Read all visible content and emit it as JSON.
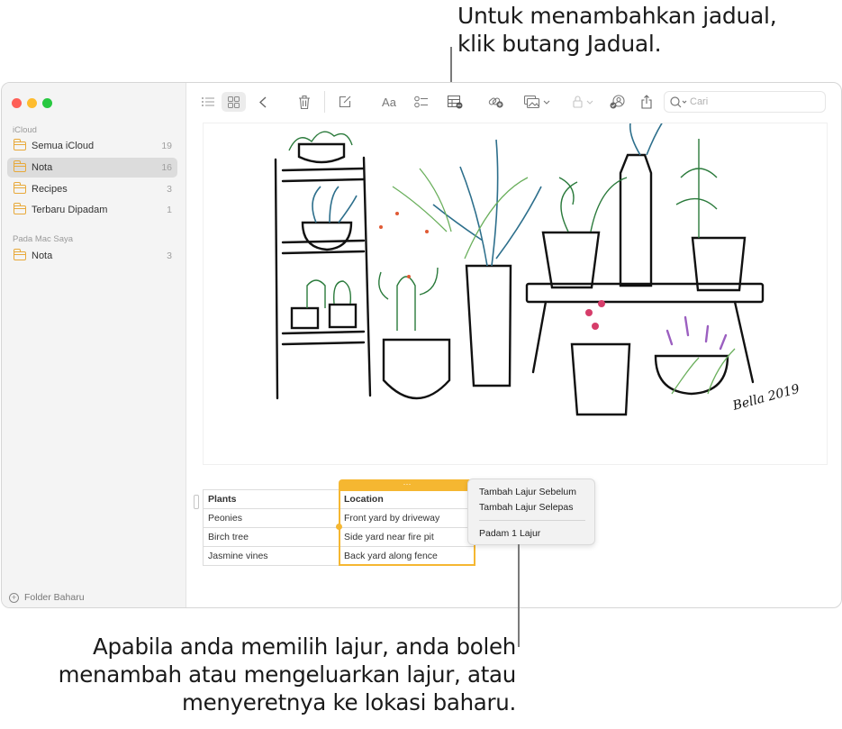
{
  "callouts": {
    "top": [
      "Untuk menambahkan jadual,",
      "klik butang Jadual."
    ],
    "bottom": [
      "Apabila anda memilih lajur, anda boleh",
      "menambah atau mengeluarkan lajur, atau",
      "menyeretnya ke lokasi baharu."
    ]
  },
  "window": {
    "traffic_lights": {
      "close": "#fe5f57",
      "minimize": "#febc2e",
      "zoom": "#28c840"
    }
  },
  "sidebar": {
    "sections": [
      {
        "label": "iCloud",
        "folders": [
          {
            "name": "Semua iCloud",
            "count": "19",
            "selected": false
          },
          {
            "name": "Nota",
            "count": "16",
            "selected": true
          },
          {
            "name": "Recipes",
            "count": "3",
            "selected": false
          },
          {
            "name": "Terbaru Dipadam",
            "count": "1",
            "selected": false
          }
        ]
      },
      {
        "label": "Pada Mac Saya",
        "folders": [
          {
            "name": "Nota",
            "count": "3",
            "selected": false
          }
        ]
      }
    ],
    "new_folder_label": "Folder Baharu"
  },
  "toolbar": {
    "buttons": [
      "list-view",
      "gallery-view",
      "back",
      "delete",
      "compose",
      "format",
      "checklist",
      "table",
      "collaborate",
      "media",
      "lock",
      "share-with",
      "share"
    ],
    "format_label": "Aa",
    "search_placeholder": "Cari"
  },
  "note": {
    "drawing": {
      "signature": "Bella 2019"
    },
    "table": {
      "headers": [
        "Plants",
        "Location"
      ],
      "rows": [
        [
          "Peonies",
          "Front yard by driveway"
        ],
        [
          "Birch tree",
          "Side yard near fire pit"
        ],
        [
          "Jasmine vines",
          "Back yard along fence"
        ]
      ],
      "selected_column": 1,
      "column_handle_label": "···"
    },
    "context_menu": {
      "items": [
        "Tambah Lajur Sebelum",
        "Tambah Lajur Selepas",
        "Padam 1 Lajur"
      ]
    }
  },
  "colors": {
    "accent": "#f5b731",
    "folder": "#e8a93a"
  }
}
